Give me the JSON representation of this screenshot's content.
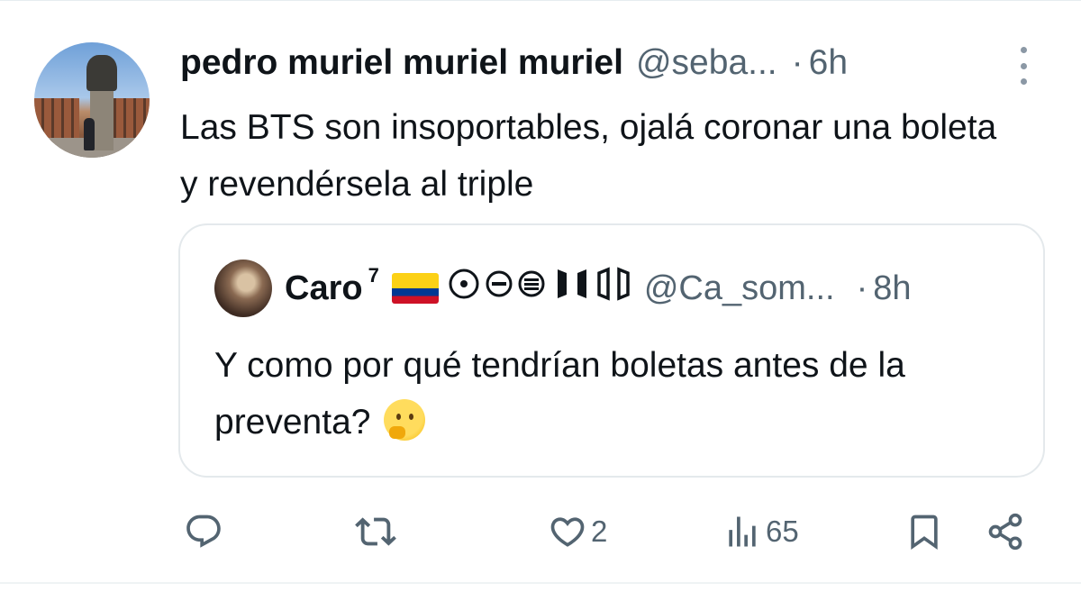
{
  "tweet": {
    "author": {
      "display_name": "pedro muriel muriel muriel",
      "handle": "@seba...",
      "separator": "·",
      "time": "6h"
    },
    "text": "Las BTS son insoportables, ojalá coronar una boleta y revendérsela al triple"
  },
  "quoted_tweet": {
    "author": {
      "display_name": "Caro",
      "superscript": "7",
      "flag": "Colombia flag",
      "handle": "@Ca_som...",
      "separator": "·",
      "time": "8h"
    },
    "text": "Y como por qué tendrían boletas antes de la preventa?",
    "emoji": "thinking-face"
  },
  "actions": {
    "reply_count": "",
    "retweet_count": "",
    "like_count": "2",
    "views_count": "65"
  },
  "colors": {
    "text_primary": "#0f1419",
    "text_secondary": "#536471",
    "border": "#e4e9ec"
  }
}
